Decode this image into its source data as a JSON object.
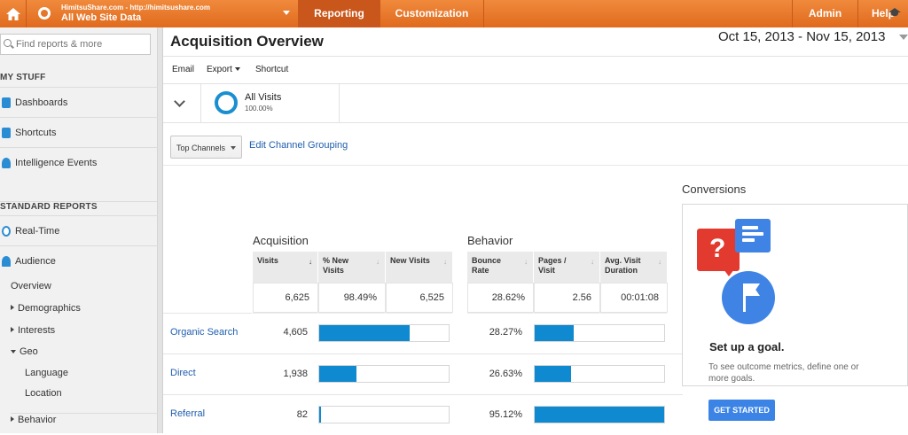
{
  "header": {
    "account_line1": "HimitsuShare.com - http://himitsushare.com",
    "account_line2": "All Web Site Data",
    "tabs": [
      {
        "label": "Reporting",
        "active": true
      },
      {
        "label": "Customization",
        "active": false
      }
    ],
    "admin_label": "Admin",
    "help_label": "Help",
    "accent_color": "#e5772d"
  },
  "sidebar": {
    "search_placeholder": "Find reports & more",
    "my_stuff_heading": "MY STUFF",
    "my_stuff_items": [
      {
        "label": "Dashboards",
        "icon": "dashboard-icon"
      },
      {
        "label": "Shortcuts",
        "icon": "shortcut-icon"
      },
      {
        "label": "Intelligence Events",
        "icon": "lightbulb-icon"
      }
    ],
    "standard_heading": "STANDARD REPORTS",
    "standard_items": [
      {
        "label": "Real-Time",
        "icon": "clock-icon"
      },
      {
        "label": "Audience",
        "icon": "people-icon"
      }
    ],
    "audience_sub": {
      "overview": "Overview",
      "demographics": "Demographics",
      "interests": "Interests",
      "geo": "Geo",
      "language": "Language",
      "location": "Location",
      "behavior": "Behavior"
    }
  },
  "main": {
    "title": "Acquisition Overview",
    "date_range": "Oct 15, 2013 - Nov 15, 2013",
    "toolbar": {
      "email": "Email",
      "export": "Export",
      "shortcut": "Shortcut"
    },
    "segment": {
      "name": "All Visits",
      "percent": "100.00%"
    },
    "channel_grouping": "Top Channels",
    "edit_grouping": "Edit Channel Grouping"
  },
  "table": {
    "acquisition_heading": "Acquisition",
    "behavior_heading": "Behavior",
    "columns": {
      "visits": "Visits",
      "pct_new_1": "% New",
      "pct_new_2": "Visits",
      "new_visits": "New Visits",
      "bounce_1": "Bounce",
      "bounce_2": "Rate",
      "pages_1": "Pages /",
      "pages_2": "Visit",
      "avg_1": "Avg. Visit",
      "avg_2": "Duration"
    },
    "totals": {
      "visits": "6,625",
      "pct_new": "98.49%",
      "new_visits": "6,525",
      "bounce": "28.62%",
      "pages": "2.56",
      "avg_duration": "00:01:08"
    },
    "rows": [
      {
        "channel": "Organic Search",
        "visits": "4,605",
        "visits_fraction": 0.7,
        "bounce": "28.27%",
        "bounce_fraction": 0.3
      },
      {
        "channel": "Direct",
        "visits": "1,938",
        "visits_fraction": 0.29,
        "bounce": "26.63%",
        "bounce_fraction": 0.28
      },
      {
        "channel": "Referral",
        "visits": "82",
        "visits_fraction": 0.012,
        "bounce": "95.12%",
        "bounce_fraction": 1.0
      }
    ],
    "bar_color": "#0f8ad0"
  },
  "conversions": {
    "heading": "Conversions",
    "goal_title": "Set up a goal.",
    "goal_desc": "To see outcome metrics, define one or more goals.",
    "button_label": "GET STARTED"
  }
}
